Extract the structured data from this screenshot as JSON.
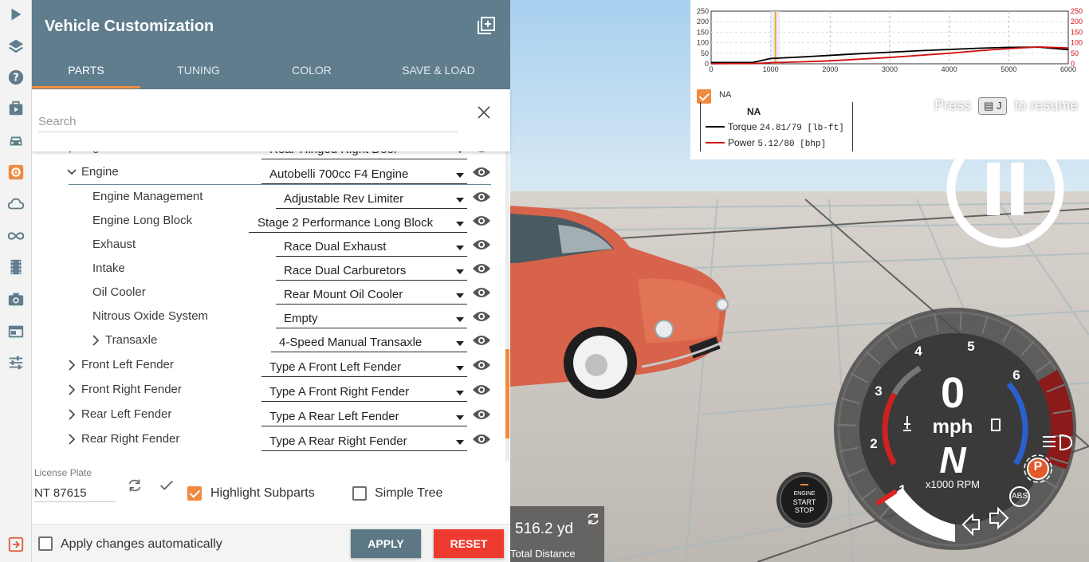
{
  "panel": {
    "title": "Vehicle Customization",
    "tabs": [
      {
        "label": "PARTS",
        "active": true
      },
      {
        "label": "TUNING",
        "active": false
      },
      {
        "label": "COLOR",
        "active": false
      },
      {
        "label": "SAVE & LOAD",
        "active": false
      }
    ],
    "search": {
      "placeholder": "Search",
      "value": ""
    }
  },
  "tree": {
    "rows": [
      {
        "name": "Right Door",
        "value": "Rear-Hinged Right Door",
        "expanded": false,
        "depth": 0,
        "partial": true
      },
      {
        "name": "Engine",
        "value": "Autobelli 700cc F4 Engine",
        "expanded": true,
        "depth": 0
      },
      {
        "name": "Engine Management",
        "value": "Adjustable Rev Limiter",
        "depth": 1
      },
      {
        "name": "Engine Long Block",
        "value": "Stage 2 Performance Long Block",
        "depth": 1
      },
      {
        "name": "Exhaust",
        "value": "Race Dual Exhaust",
        "depth": 1
      },
      {
        "name": "Intake",
        "value": "Race Dual Carburetors",
        "depth": 1
      },
      {
        "name": "Oil Cooler",
        "value": "Rear Mount Oil Cooler",
        "depth": 1
      },
      {
        "name": "Nitrous Oxide System",
        "value": "Empty",
        "depth": 1
      },
      {
        "name": "Transaxle",
        "value": "4-Speed Manual Transaxle",
        "expanded": false,
        "depth": 1
      },
      {
        "name": "Front Left Fender",
        "value": "Type A Front Left Fender",
        "expanded": false,
        "depth": 0
      },
      {
        "name": "Front Right Fender",
        "value": "Type A Front Right Fender",
        "expanded": false,
        "depth": 0
      },
      {
        "name": "Rear Left Fender",
        "value": "Type A Rear Left Fender",
        "expanded": false,
        "depth": 0
      },
      {
        "name": "Rear Right Fender",
        "value": "Type A Rear Right Fender",
        "expanded": false,
        "depth": 0
      }
    ]
  },
  "license": {
    "label": "License Plate",
    "value": "NT 87615"
  },
  "options": {
    "highlight_subparts": {
      "label": "Highlight Subparts",
      "checked": true
    },
    "simple_tree": {
      "label": "Simple Tree",
      "checked": false
    },
    "apply_auto": {
      "label": "Apply changes automatically",
      "checked": false
    }
  },
  "buttons": {
    "apply": "APPLY",
    "reset": "RESET"
  },
  "graph": {
    "left_ticks": [
      "250",
      "200",
      "150",
      "100",
      "50",
      "0"
    ],
    "right_ticks": [
      "250",
      "200",
      "150",
      "100",
      "50",
      "0"
    ],
    "x_ticks": [
      "0",
      "1000",
      "2000",
      "3000",
      "4000",
      "5000",
      "6000"
    ],
    "config_name": "NA",
    "legend_title": "NA",
    "torque_label": "Torque",
    "torque_value": "24.81/79 [lb-ft]",
    "power_label": "Power",
    "power_value": "5.12/80  [bhp]",
    "colors": {
      "torque": "#000000",
      "power": "#d01010",
      "cursor": "#f5a623"
    }
  },
  "chart_data": {
    "type": "line",
    "xlabel": "",
    "ylabel": "",
    "xlim": [
      0,
      6000
    ],
    "ylim": [
      0,
      250
    ],
    "x": [
      0,
      300,
      700,
      1000,
      1500,
      2000,
      2500,
      3000,
      3500,
      4000,
      4500,
      5000,
      5500,
      6000
    ],
    "series": [
      {
        "name": "Torque",
        "values": [
          6,
          6,
          6,
          25,
          32,
          40,
          48,
          55,
          62,
          68,
          74,
          78,
          79,
          67
        ]
      },
      {
        "name": "Power",
        "values": [
          0,
          1,
          1,
          5,
          9,
          14,
          22,
          30,
          40,
          50,
          62,
          72,
          80,
          75
        ]
      }
    ],
    "cursor_x": 1080,
    "grid": true
  },
  "hud": {
    "resume_press": "Press",
    "resume_key": "J",
    "resume_text": "to resume",
    "distance_value": "516.2 yd",
    "distance_label": "Total Distance",
    "engine_line1": "ENGINE",
    "engine_line2": "START",
    "engine_line3": "STOP"
  },
  "gauge": {
    "speed": "0",
    "unit": "mph",
    "gear": "N",
    "rpm_label": "x1000 RPM",
    "ticks": [
      "1",
      "2",
      "3",
      "4",
      "5",
      "6"
    ],
    "parking": "P",
    "abs": "ABS",
    "rpm_fraction": 0.0
  },
  "rail": {
    "icons": [
      "play-icon",
      "layers-icon",
      "help-icon",
      "mission-icon",
      "car-icon",
      "vehicle-config-icon",
      "cloud-icon",
      "infinity-icon",
      "film-icon",
      "camera-icon",
      "window-icon",
      "sliders-icon",
      "exit-icon"
    ]
  }
}
